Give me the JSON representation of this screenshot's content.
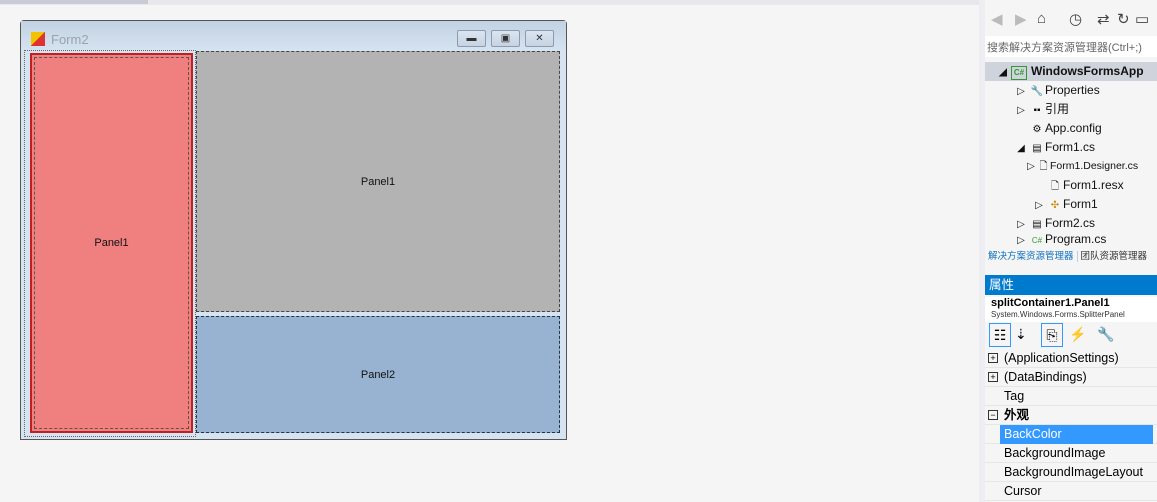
{
  "designer": {
    "form_title": "Form2",
    "panel_left": "Panel1",
    "panel_top_right": "Panel1",
    "panel_bottom_right": "Panel2",
    "colors": {
      "panel_left": "#f08080",
      "panel_top_right": "#b3b3b3",
      "panel_bottom_right": "#98b3d1"
    }
  },
  "solution_explorer": {
    "search_placeholder": "搜索解决方案资源管理器(Ctrl+;)",
    "items": [
      {
        "label": "WindowsFormsApp",
        "icon": "csharp-project-icon"
      },
      {
        "label": "Properties",
        "icon": "wrench-icon"
      },
      {
        "label": "引用",
        "icon": "references-icon"
      },
      {
        "label": "App.config",
        "icon": "config-icon"
      },
      {
        "label": "Form1.cs",
        "icon": "form-icon"
      },
      {
        "label": "Form1.Designer.cs",
        "icon": "file-icon"
      },
      {
        "label": "Form1.resx",
        "icon": "file-icon"
      },
      {
        "label": "Form1",
        "icon": "class-icon"
      },
      {
        "label": "Form2.cs",
        "icon": "form-icon"
      },
      {
        "label": "Program.cs",
        "icon": "csharp-file-icon"
      }
    ],
    "tabs": [
      "解决方案资源管理器",
      "团队资源管理器"
    ]
  },
  "properties": {
    "title": "属性",
    "object": "splitContainer1.Panel1",
    "object_type": "System.Windows.Forms.SplitterPanel",
    "rows": [
      {
        "label": "(ApplicationSettings)",
        "expander": "+"
      },
      {
        "label": "(DataBindings)",
        "expander": "+"
      },
      {
        "label": "Tag",
        "expander": ""
      },
      {
        "label": "外观",
        "expander": "−"
      },
      {
        "label": "BackColor",
        "expander": ""
      },
      {
        "label": "BackgroundImage",
        "expander": ""
      },
      {
        "label": "BackgroundImageLayout",
        "expander": ""
      },
      {
        "label": "Cursor",
        "expander": ""
      }
    ]
  }
}
